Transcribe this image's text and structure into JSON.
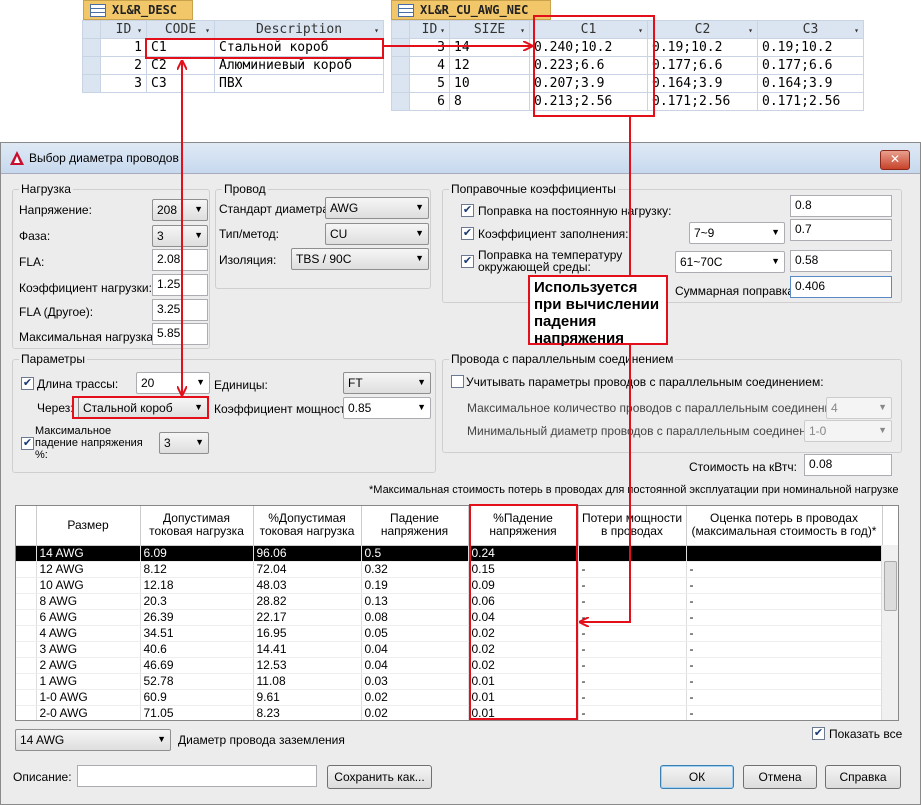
{
  "desc_table": {
    "tab_title": "XL&R_DESC",
    "headers": [
      "ID",
      "CODE",
      "Description"
    ],
    "rows": [
      {
        "id": "1",
        "code": "C1",
        "desc": "Стальной короб"
      },
      {
        "id": "2",
        "code": "C2",
        "desc": "Алюминиевый короб"
      },
      {
        "id": "3",
        "code": "C3",
        "desc": "ПВХ"
      }
    ]
  },
  "awg_table": {
    "tab_title": "XL&R_CU_AWG_NEC",
    "headers": [
      "ID",
      "SIZE",
      "C1",
      "C2",
      "C3"
    ],
    "rows": [
      {
        "id": "3",
        "size": "14",
        "c1": "0.240;10.2",
        "c2": "0.19;10.2",
        "c3": "0.19;10.2"
      },
      {
        "id": "4",
        "size": "12",
        "c1": "0.223;6.6",
        "c2": "0.177;6.6",
        "c3": "0.177;6.6"
      },
      {
        "id": "5",
        "size": "10",
        "c1": "0.207;3.9",
        "c2": "0.164;3.9",
        "c3": "0.164;3.9"
      },
      {
        "id": "6",
        "size": "8",
        "c1": "0.213;2.56",
        "c2": "0.171;2.56",
        "c3": "0.171;2.56"
      }
    ]
  },
  "dialog": {
    "title": "Выбор диаметра проводов",
    "close": "✕",
    "load": {
      "title": "Нагрузка",
      "voltage_label": "Напряжение:",
      "voltage": "208",
      "phase_label": "Фаза:",
      "phase": "3",
      "fla_label": "FLA:",
      "fla": "2.08",
      "load_factor_label": "Коэффициент нагрузки:",
      "load_factor": "1.25",
      "fla_other_label": "FLA (Другое):",
      "fla_other": "3.25",
      "max_load_label": "Максимальная нагрузка:",
      "max_load": "5.85"
    },
    "wire": {
      "title": "Провод",
      "standard_label": "Стандарт диаметра:",
      "standard": "AWG",
      "type_label": "Тип/метод:",
      "type": "CU",
      "insulation_label": "Изоляция:",
      "insulation": "TBS / 90C"
    },
    "correction": {
      "title": "Поправочные коэффициенты",
      "continuous_label": "Поправка на постоянную нагрузку:",
      "continuous": "0.8",
      "fill_label": "Коэффициент заполнения:",
      "fill_select": "7~9",
      "fill": "0.7",
      "temp_label_1": "Поправка на температуру",
      "temp_label_2": "окружающей среды:",
      "temp_select": "61~70C",
      "temp": "0.58",
      "total_label": "Суммарная поправка:",
      "total": "0.406"
    },
    "params": {
      "title": "Параметры",
      "length_label": "Длина трассы:",
      "length": "20",
      "units_label": "Единицы:",
      "units": "FT",
      "via_label": "Через:",
      "via": "Стальной короб",
      "pf_label": "Коэффициент мощности:",
      "pf": "0.85",
      "vdrop_label_1": "Максимальное",
      "vdrop_label_2": "падение напряжения",
      "vdrop_label_3": "%:",
      "vdrop": "3"
    },
    "parallel": {
      "title": "Провода с параллельным соединением",
      "consider_label": "Учитывать параметры проводов с параллельным соединением:",
      "max_label": "Максимальное количество проводов с параллельным соединением:",
      "max": "4",
      "min_label": "Минимальный диаметр проводов с параллельным соединением:",
      "min": "1-0"
    },
    "cost_label": "Стоимость на кВтч:",
    "cost": "0.08",
    "note": "*Максимальная стоимость потерь в проводах для постоянной эксплуатации при номинальной нагрузке",
    "grid": {
      "headers": [
        "Размер",
        "Допустимая токовая нагрузка",
        "%Допустимая токовая нагрузка",
        "Падение напряжения",
        "%Падение напряжения",
        "Потери мощности в проводах",
        "Оценка потерь в проводах (максимальная стоимость в год)*"
      ],
      "rows": [
        [
          "14 AWG",
          "6.09",
          "96.06",
          "0.5",
          "0.24",
          "",
          ""
        ],
        [
          "12 AWG",
          "8.12",
          "72.04",
          "0.32",
          "0.15",
          "-",
          "-"
        ],
        [
          "10 AWG",
          "12.18",
          "48.03",
          "0.19",
          "0.09",
          "-",
          "-"
        ],
        [
          "8 AWG",
          "20.3",
          "28.82",
          "0.13",
          "0.06",
          "-",
          "-"
        ],
        [
          "6 AWG",
          "26.39",
          "22.17",
          "0.08",
          "0.04",
          "-",
          "-"
        ],
        [
          "4 AWG",
          "34.51",
          "16.95",
          "0.05",
          "0.02",
          "-",
          "-"
        ],
        [
          "3 AWG",
          "40.6",
          "14.41",
          "0.04",
          "0.02",
          "-",
          "-"
        ],
        [
          "2 AWG",
          "46.69",
          "12.53",
          "0.04",
          "0.02",
          "-",
          "-"
        ],
        [
          "1 AWG",
          "52.78",
          "11.08",
          "0.03",
          "0.01",
          "-",
          "-"
        ],
        [
          "1-0 AWG",
          "60.9",
          "9.61",
          "0.02",
          "0.01",
          "-",
          "-"
        ],
        [
          "2-0 AWG",
          "71.05",
          "8.23",
          "0.02",
          "0.01",
          "-",
          "-"
        ]
      ]
    },
    "ground_select": "14 AWG",
    "ground_label": "Диаметр провода заземления",
    "show_all_label": "Показать все",
    "desc_label": "Описание:",
    "save_as": "Сохранить как...",
    "ok": "ОК",
    "cancel": "Отмена",
    "help": "Справка"
  },
  "callout": "Используется при вычислении падения напряжения",
  "colors": {
    "annotation": "#e3101b",
    "tab": "#f2c76a",
    "header": "#dbe5f1"
  }
}
